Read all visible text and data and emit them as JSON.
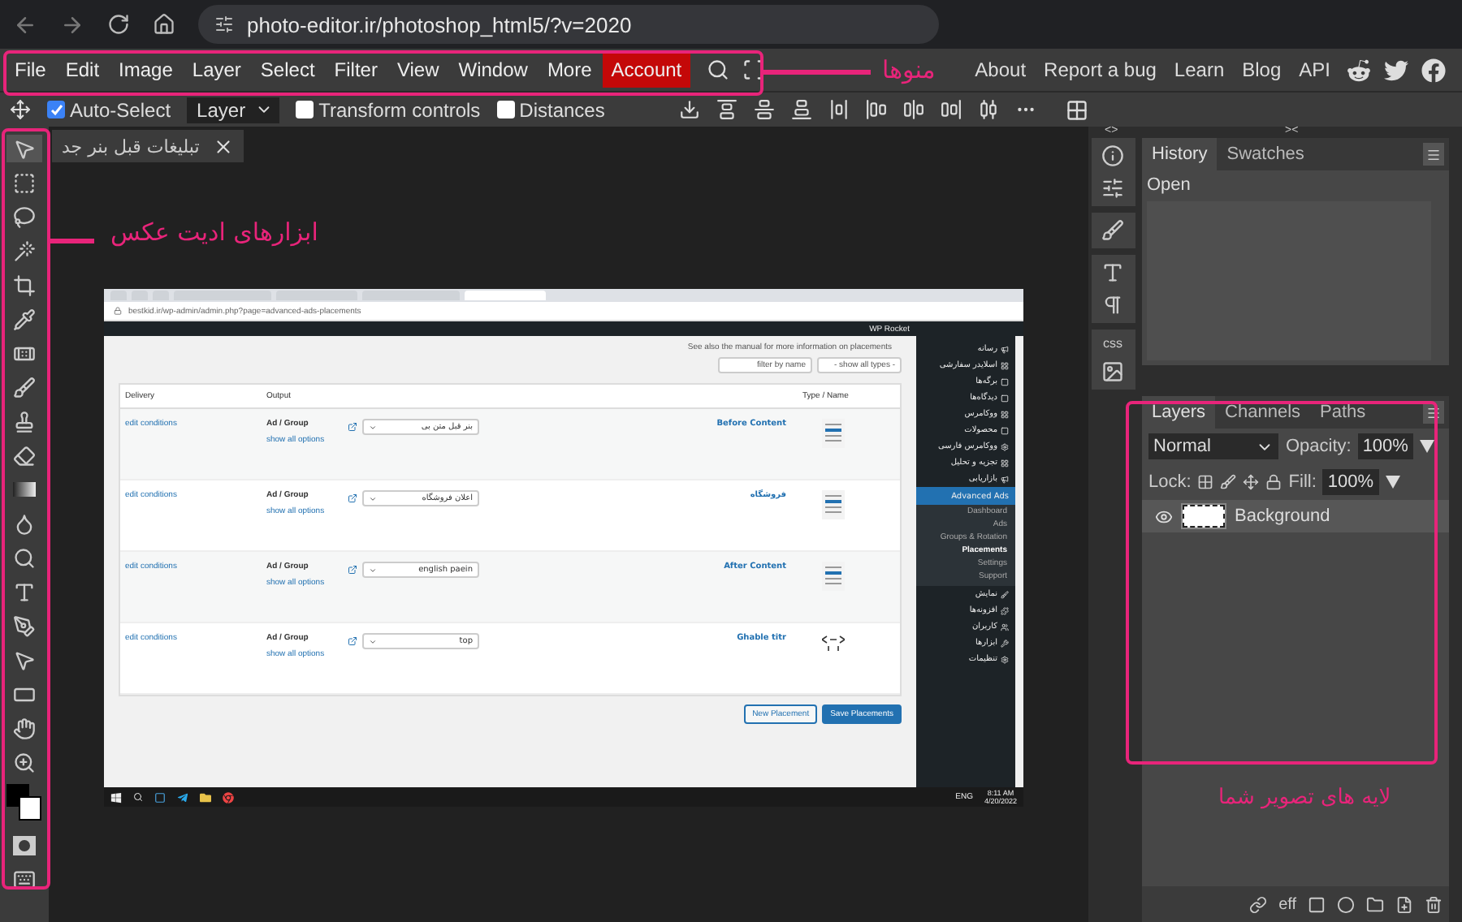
{
  "browser": {
    "url": "photo-editor.ir/photoshop_html5/?v=2020"
  },
  "menu": [
    {
      "label": "File",
      "highlighted": false
    },
    {
      "label": "Edit",
      "highlighted": false
    },
    {
      "label": "Image",
      "highlighted": false
    },
    {
      "label": "Layer",
      "highlighted": false
    },
    {
      "label": "Select",
      "highlighted": false
    },
    {
      "label": "Filter",
      "highlighted": false
    },
    {
      "label": "View",
      "highlighted": false
    },
    {
      "label": "Window",
      "highlighted": false
    },
    {
      "label": "More",
      "highlighted": false
    },
    {
      "label": "Account",
      "highlighted": true
    }
  ],
  "links": [
    "About",
    "Report a bug",
    "Learn",
    "Blog",
    "API"
  ],
  "options_bar": [
    {
      "kind": "checkbox",
      "label": "Auto-Select",
      "checked": true
    },
    {
      "kind": "select",
      "value": "Layer"
    },
    {
      "kind": "checkbox",
      "label": "Transform controls",
      "checked": false
    },
    {
      "kind": "checkbox",
      "label": "Distances",
      "checked": false
    }
  ],
  "document_tab": {
    "title": "تبلیغات قبل بنر جد"
  },
  "image": {
    "url": "bestkid.ir/wp-admin/admin.php?page=advanced-ads-placements",
    "admin_bar": "WP Rocket",
    "notice": "See also the manual for more information on placements",
    "filter_placeholder": "filter by name",
    "type_filter": "- show all types -",
    "columns": [
      "Delivery",
      "Output",
      "Type / Name"
    ],
    "rows": [
      {
        "delivery": "edit conditions",
        "output": "Ad / Group",
        "options": "show all options",
        "value": "بنر قبل متن بی",
        "name": "Before Content",
        "kind": "layout"
      },
      {
        "delivery": "edit conditions",
        "output": "Ad / Group",
        "options": "show all options",
        "value": "اعلان فروشگاه",
        "name": "فروشگاه",
        "kind": "layout"
      },
      {
        "delivery": "edit conditions",
        "output": "Ad / Group",
        "options": "show all options",
        "value": "english paein",
        "name": "After Content",
        "kind": "layout"
      },
      {
        "delivery": "edit conditions",
        "output": "Ad / Group",
        "options": "show all options",
        "value": "top",
        "name": "Ghable titr",
        "kind": "code"
      }
    ],
    "buttons": [
      {
        "label": "New Placement",
        "primary": false
      },
      {
        "label": "Save Placements",
        "primary": true
      }
    ],
    "sidebar": [
      {
        "label": "رسانه",
        "selected": false
      },
      {
        "label": "اسلایدر سفارشی",
        "selected": false
      },
      {
        "label": "برگه‌ها",
        "selected": false
      },
      {
        "label": "دیدگاه‌ها",
        "selected": false
      },
      {
        "label": "ووکامرس",
        "selected": false
      },
      {
        "label": "محصولات",
        "selected": false
      },
      {
        "label": "ووکامرس فارسی",
        "selected": false
      },
      {
        "label": "تجزیه و تحلیل",
        "selected": false
      },
      {
        "label": "بازاریابی",
        "selected": false
      },
      {
        "label": "Advanced Ads",
        "selected": true,
        "children": [
          {
            "label": "Dashboard",
            "selected": false
          },
          {
            "label": "Ads",
            "selected": false
          },
          {
            "label": "Groups & Rotation",
            "selected": false
          },
          {
            "label": "Placements",
            "selected": true
          },
          {
            "label": "Settings",
            "selected": false
          },
          {
            "label": "Support",
            "selected": false
          }
        ]
      },
      {
        "label": "نمایش",
        "selected": false
      },
      {
        "label": "افزونه‌ها",
        "selected": false
      },
      {
        "label": "کاربران",
        "selected": false
      },
      {
        "label": "ابزارها",
        "selected": false
      },
      {
        "label": "تنظیمات",
        "selected": false
      }
    ],
    "taskbar": {
      "language": "ENG",
      "time": "8:11 AM",
      "date": "4/20/2022"
    }
  },
  "collapse_marks": [
    "<>",
    "><"
  ],
  "history_panel": {
    "tabs": [
      {
        "label": "History",
        "selected": true
      },
      {
        "label": "Swatches",
        "selected": false
      }
    ],
    "items": [
      "Open"
    ]
  },
  "layers_panel": {
    "tabs": [
      {
        "label": "Layers",
        "selected": true
      },
      {
        "label": "Channels",
        "selected": false
      },
      {
        "label": "Paths",
        "selected": false
      }
    ],
    "blend_mode": "Normal",
    "opacity_label": "Opacity:",
    "opacity": "100%",
    "lock_label": "Lock:",
    "fill_label": "Fill:",
    "fill": "100%",
    "layers": [
      {
        "name": "Background",
        "visible": true,
        "selected": true
      }
    ],
    "effects_label": "eff"
  },
  "side_icons_label": "css",
  "annotations": [
    {
      "text": "منوها"
    },
    {
      "text": "ابزارهای ادیت عکس"
    },
    {
      "text": "لایه های تصویر شما"
    }
  ]
}
